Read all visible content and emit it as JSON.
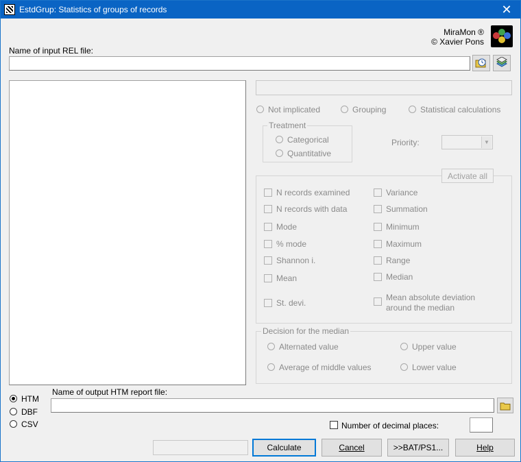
{
  "window": {
    "title": "EstdGrup: Statistics of groups of records",
    "close_glyph": "✕"
  },
  "branding": {
    "product": "MiraMon ®",
    "author": "© Xavier Pons"
  },
  "input_file": {
    "label": "Name of input REL file:",
    "value": ""
  },
  "role": {
    "options": [
      "Not implicated",
      "Grouping",
      "Statistical calculations"
    ]
  },
  "treatment": {
    "title": "Treatment",
    "options": [
      "Categorical",
      "Quantitative"
    ]
  },
  "priority": {
    "label": "Priority:",
    "value": ""
  },
  "stats": {
    "activate_all": "Activate all",
    "left": [
      "N records examined",
      "N records with data",
      "Mode",
      "% mode",
      "Shannon i.",
      "Mean",
      "St. devi."
    ],
    "right": [
      "Variance",
      "Summation",
      "Minimum",
      "Maximum",
      "Range",
      "Median",
      "Mean absolute deviation",
      "around the median"
    ]
  },
  "median": {
    "title": "Decision for the median",
    "options": [
      "Alternated value",
      "Upper value",
      "Average of middle values",
      "Lower value"
    ]
  },
  "format": {
    "options": [
      "HTM",
      "DBF",
      "CSV"
    ],
    "selected": "HTM"
  },
  "output_file": {
    "label": "Name of output HTM report file:",
    "value": ""
  },
  "decimals": {
    "label": "Number of decimal places:",
    "value": ""
  },
  "buttons": {
    "calculate": "Calculate",
    "cancel": "Cancel",
    "batch": ">>BAT/PS1...",
    "help": "Help"
  },
  "colors": {
    "titlebar": "#0a64c4",
    "accent": "#0078d7",
    "disabled_text": "#8a8a8a"
  }
}
